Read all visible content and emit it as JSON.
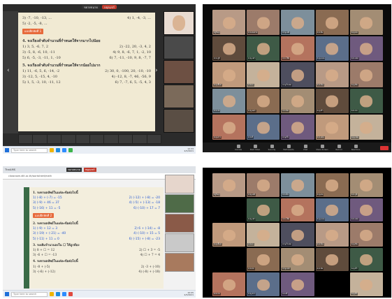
{
  "top_left": {
    "toolbar_labels": [
      "ขยายขนาด",
      "หยุดแชร์"
    ],
    "worksheet": {
      "lines": [
        {
          "left": "3) -7, -10, -13, ...",
          "right": "4) 1, -4, -3, ..."
        },
        {
          "left": "5) -2, -5, -8, ...",
          "right": ""
        }
      ],
      "tag": "แบบฝึกหัดที่ 1",
      "q4": "4. จงเรียงลำดับจำนวนที่กำหนดให้จากมากไปน้อย",
      "q4_items": [
        {
          "left": "1) 3, 5, -6, 7, 2",
          "right": "2) -22, 20, -3, 4, 2"
        },
        {
          "left": "3) -5, 8, -6, 10, -11",
          "right": "4) 9, 8, -6, 7, 1, -2, 10"
        },
        {
          "left": "5) 6, -5, -3, -11, 1, -10",
          "right": "6) 7, -11, -10, 9, 8, -7, 7"
        }
      ],
      "q5": "5. จงเรียงลำดับจำนวนที่กำหนดให้จากน้อยไปมาก",
      "q5_items": [
        {
          "left": "1) 11, -6, 5, 6, -14, -2",
          "right": "2) 30, 0, -100, 20, -10, -10"
        },
        {
          "left": "3) -12, 5, -15, 4, -10",
          "right": "4) -12, 8, -7, 46, -56, 9"
        },
        {
          "left": "5) 1, 5, -3, 10, -11, 12",
          "right": "6) 7, -7, 6, 5, -5, 4, 3"
        }
      ]
    },
    "taskbar_search": "Type here to search",
    "taskbar_time": "12:33",
    "taskbar_date": "2/3/2021"
  },
  "top_right": {
    "participants": [
      "ครูใหญ่",
      "ด.ช.สมชาย",
      "ด.ญ.มณี",
      "ด.ช.ต้น",
      "ด.ญ.ฝน",
      "ด.ช.ภูมิ",
      "ด.ญ.ปลา",
      "ด.ช.โอ๊ต",
      "ด.ญ.แนน",
      "ด.ช.บอล",
      "ด.ญ.มิ้นท์",
      "ด.ช.เจ",
      "ด.ญ.ใบเตย",
      "ด.ช.ก้อง",
      "ด.ญ.ขิม",
      "ด.ช.ปอ",
      "ด.ญ.แพร",
      "ด.ช.นัท",
      "ด.ญ.ฟ้า",
      "ด.ช.เก่ง",
      "ด.ญ.ดาว",
      "ด.ช.ตี๋",
      "ด.ญ.อิ๋ว",
      "ด.ช.ม่อน",
      "ด.ญ.จอย"
    ],
    "controls": [
      "Unmute",
      "Start Video",
      "Security",
      "Participants",
      "Chat",
      "Share Screen",
      "Record",
      "Reactions"
    ],
    "end_label": "End"
  },
  "bottom_left": {
    "tab_title": "ThaiLMS",
    "address": "classroom.dlit.ac.th/worksheet/math",
    "toolbar_labels": [
      "ขยายขนาด",
      "หยุดแชร์"
    ],
    "worksheet": {
      "q1": "1. จงหาผลลัพธ์ในแต่ละข้อต่อไปนี้",
      "q1_items": [
        {
          "left": "1) (-8) + (-7) = -15",
          "right": "2) (-12) + (-8) = -20"
        },
        {
          "left": "3) (-9) + 46 = 37",
          "right": "4) (-5) + (-13) = -18"
        },
        {
          "left": "5) (-16) + 11 = -5",
          "right": "6) (-10) + 17 = 7"
        }
      ],
      "tag": "แบบฝึกหัดที่ 2",
      "q2": "2. จงหาผลลัพธ์ในแต่ละข้อต่อไปนี้",
      "q2_items": [
        {
          "left": "1) (-9) + 12 = 3",
          "right": "2) 6 + (-14) = -8"
        },
        {
          "left": "3) (-19) + (-21) = -40",
          "right": "4) (-10) + 15 = 5"
        },
        {
          "left": "5) (-11) + 11 = 0",
          "right": "6) (-15) + (-8) = -23"
        }
      ],
      "q3": "3. จงเติมจำนวนลงใน ☐ ให้ถูกต้อง",
      "q3_items": [
        {
          "left": "1) 8 + ☐ = 12",
          "right": "2) ☐ + 3 = -5"
        },
        {
          "left": "3) -6 + ☐ = -13",
          "right": "4) ☐ + 7 = 4"
        }
      ],
      "q4": "4. จงหาผลลัพธ์ในแต่ละข้อต่อไปนี้",
      "q4_items": [
        {
          "left": "1) -8 + (-5)",
          "right": "2) -3 + (-10)"
        },
        {
          "left": "3) -(-6) + (-12)",
          "right": "4) (-8) + (-18)"
        }
      ]
    },
    "taskbar_search": "Type here to search",
    "taskbar_time": "10:05",
    "taskbar_date": "2/3/2021"
  },
  "bottom_right": {
    "participants": [
      "ครูใหญ่",
      "ด.ญ.มณี",
      "ด.ช.ต้น",
      "ด.ญ.ฝน",
      "ด.ช.ภูมิ",
      "ด.ญ.ปลา",
      "ด.ช.โอ๊ต",
      "ด.ญ.แนน",
      "ด.ช.บอล",
      "ด.ญ.มิ้นท์",
      "ด.ช.เจ",
      "ด.ญ.ใบเตย",
      "ด.ช.ก้อง",
      "ด.ญ.ขิม",
      "ด.ช.ปอ",
      "ด.ญ.แพร",
      "ด.ช.นัท",
      "ด.ญ.ฟ้า",
      "ด.ช.เก่ง",
      "ด.ญ.ดาว",
      "ด.ช.ตี๋",
      "ด.ญ.อิ๋ว"
    ]
  },
  "colors": {
    "zoom_dark": "#1a1a1a",
    "end_red": "#dd3333",
    "tag_orange": "#e76a3c",
    "pen_blue": "#2659d4",
    "paper": "#f1ead3"
  }
}
